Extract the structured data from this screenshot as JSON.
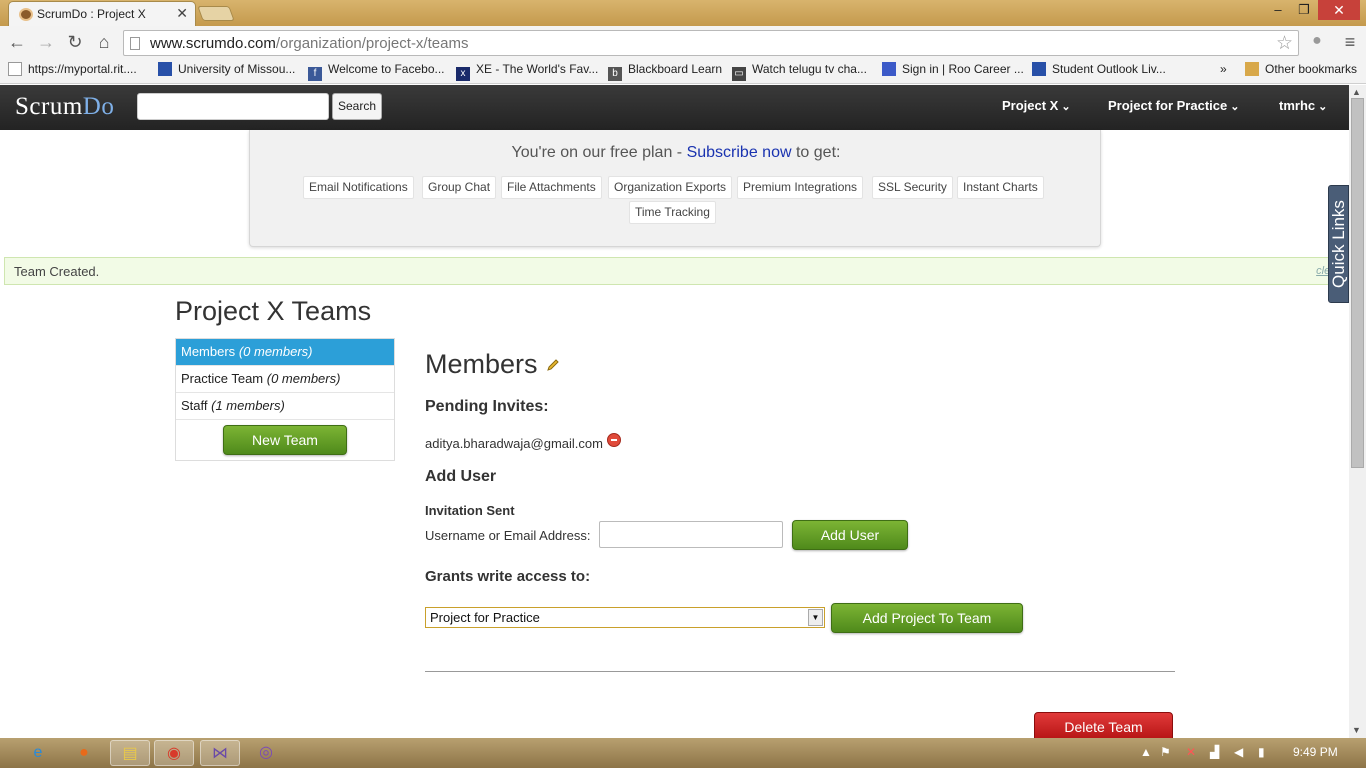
{
  "browser": {
    "tab_title": "ScrumDo : Project X",
    "tab_close": "✕",
    "url_host": "www.scrumdo.com",
    "url_path": "/organization/project-x/teams",
    "window_controls": {
      "minimize": "–",
      "restore": "❐",
      "close": "✕"
    },
    "nav": {
      "back": "←",
      "forward": "→",
      "reload": "↻",
      "home": "⌂",
      "menu": "≡"
    },
    "star_icon": "☆",
    "bookmarks": [
      {
        "label": "https://myportal.rit....",
        "icon": "page-icon"
      },
      {
        "label": "University of Missou...",
        "icon": "flag-icon"
      },
      {
        "label": "Welcome to Facebo...",
        "icon": "facebook-icon"
      },
      {
        "label": "XE - The World's Fav...",
        "icon": "xe-icon"
      },
      {
        "label": "Blackboard Learn",
        "icon": "blackboard-icon"
      },
      {
        "label": "Watch telugu tv cha...",
        "icon": "tv-icon"
      },
      {
        "label": "Sign in | Roo Career ...",
        "icon": "roo-icon"
      },
      {
        "label": "Student Outlook Liv...",
        "icon": "flag-icon"
      }
    ],
    "bookmarks_more": "»",
    "other_bookmarks": "Other bookmarks"
  },
  "header": {
    "logo_main": "Scrum",
    "logo_accent": "Do",
    "search_button": "Search",
    "search_value": "",
    "menus": [
      "Project X",
      "Project for Practice",
      "tmrhc"
    ]
  },
  "promo": {
    "text_before": "You're on our free plan - ",
    "link": "Subscribe now",
    "text_after": " to get:",
    "features": [
      "Email Notifications",
      "Group Chat",
      "File Attachments",
      "Organization Exports",
      "Premium Integrations",
      "SSL Security",
      "Instant Charts",
      "Time Tracking"
    ]
  },
  "notice": {
    "text": "Team Created.",
    "clear": "clear"
  },
  "quick_links": "Quick Links",
  "page_title": "Project X Teams",
  "teams": [
    {
      "name": "Members",
      "count": "(0 members)",
      "active": true
    },
    {
      "name": "Practice Team",
      "count": "(0 members)",
      "active": false
    },
    {
      "name": "Staff",
      "count": "(1 members)",
      "active": false
    }
  ],
  "new_team_button": "New Team",
  "team_detail": {
    "title": "Members",
    "pending_heading": "Pending Invites:",
    "pending_email": "aditya.bharadwaja@gmail.com",
    "add_user_heading": "Add User",
    "invitation_status": "Invitation Sent",
    "username_label": "Username or Email Address:",
    "username_value": "",
    "add_user_button": "Add User",
    "grants_heading": "Grants write access to:",
    "project_select_value": "Project for Practice",
    "add_project_button": "Add Project To Team",
    "delete_button": "Delete Team"
  },
  "taskbar": {
    "apps": [
      "ie-icon",
      "firefox-icon",
      "explorer-icon",
      "chrome-icon",
      "visual-studio-icon",
      "viber-icon"
    ],
    "clock": "9:49 PM"
  }
}
